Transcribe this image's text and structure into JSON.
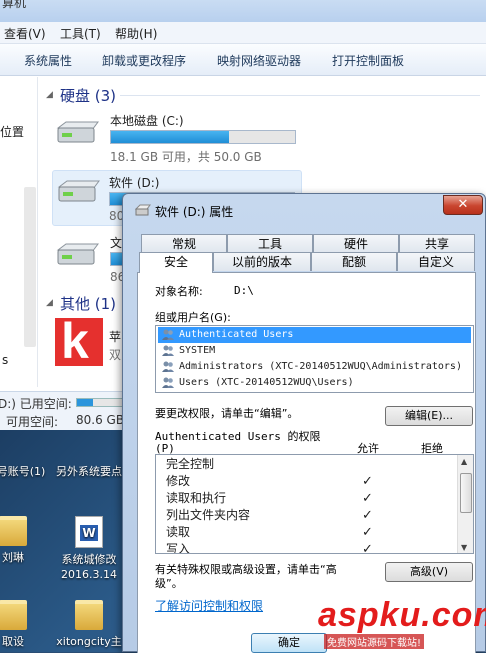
{
  "explorer": {
    "title_fragment": "算机",
    "menu": [
      "查看(V)",
      "工具(T)",
      "帮助(H)"
    ],
    "toolbar": [
      "系统属性",
      "卸载或更改程序",
      "映射网络驱动器",
      "打开控制面板"
    ],
    "nav_items": [
      "位置",
      "s"
    ],
    "hard_drives_header": "硬盘 (3)",
    "drives": [
      {
        "name": "本地磁盘 (C:)",
        "info": "18.1 GB 可用，共 50.0 GB",
        "used": 0.64
      },
      {
        "name": "软件 (D:)",
        "info": "80",
        "used": 0.6
      },
      {
        "name": "文",
        "info": "86",
        "used": 0.7
      }
    ],
    "other_header": "其他 (1)",
    "other_item_line1": "苹",
    "other_item_line2": "双",
    "status": {
      "line1_label": "D:) 已用空间:",
      "line2_label": "可用空间:",
      "line2_value": "80.6 GB"
    }
  },
  "desktop": {
    "icons": [
      {
        "label": "号账号(1)"
      },
      {
        "label": "另外系统要点"
      },
      {
        "label": "刘琳"
      },
      {
        "label": "系统城修改 2016.3.14"
      },
      {
        "label": "取设"
      },
      {
        "label": "xitongcity主"
      }
    ]
  },
  "dialog": {
    "title": "软件 (D:) 属性",
    "close": "✕",
    "tabs_row1": [
      "常规",
      "工具",
      "硬件",
      "共享"
    ],
    "tabs_row2": [
      "安全",
      "以前的版本",
      "配额",
      "自定义"
    ],
    "object_name_label": "对象名称:",
    "object_name_value": "D:\\",
    "group_label": "组或用户名(G):",
    "users": [
      "Authenticated Users",
      "SYSTEM",
      "Administrators (XTC-20140512WUQ\\Administrators)",
      "Users (XTC-20140512WUQ\\Users)"
    ],
    "change_perm_text": "要更改权限，请单击“编辑”。",
    "edit_button": "编辑(E)...",
    "perm_for_label_1": "Authenticated Users 的权限",
    "perm_for_label_2": "(P)",
    "allow_header": "允许",
    "deny_header": "拒绝",
    "permissions": [
      {
        "name": "完全控制",
        "allow": ""
      },
      {
        "name": "修改",
        "allow": "✓"
      },
      {
        "name": "读取和执行",
        "allow": "✓"
      },
      {
        "name": "列出文件夹内容",
        "allow": "✓"
      },
      {
        "name": "读取",
        "allow": "✓"
      },
      {
        "name": "写入",
        "allow": "✓"
      }
    ],
    "special_text_1": "有关特殊权限或高级设置，请单击“高",
    "special_text_2": "级”。",
    "advanced_button": "高级(V)",
    "learn_link": "了解访问控制和权限",
    "ok_button": "确定"
  },
  "watermark": {
    "main": "aspku.com",
    "sub": "免费网站源码下载站!"
  }
}
